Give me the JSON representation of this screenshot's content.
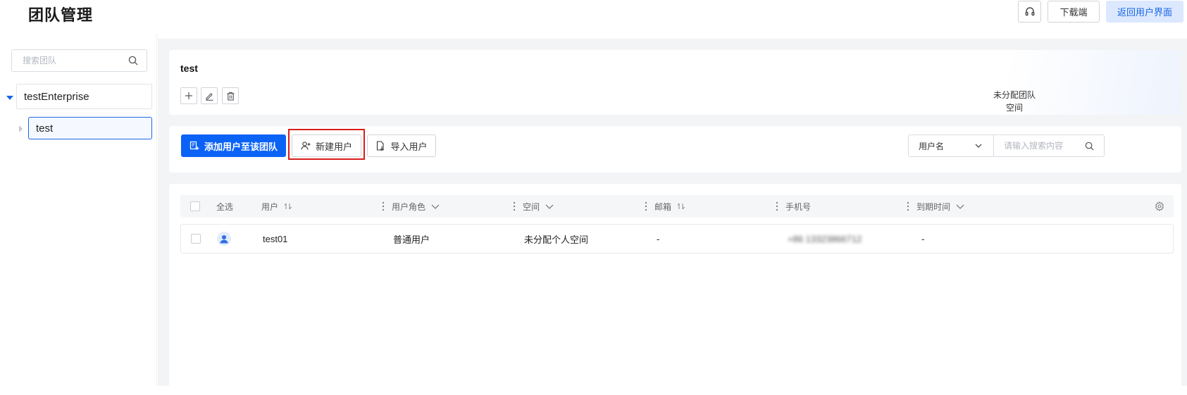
{
  "header": {
    "title": "团队管理",
    "download_label": "下载端",
    "back_label": "返回用户界面"
  },
  "sidebar": {
    "search_placeholder": "搜索团队",
    "tree": {
      "enterprise": "testEnterprise",
      "team": "test"
    }
  },
  "team_card": {
    "name": "test",
    "unassigned_space_line1": "未分配团队",
    "unassigned_space_line2": "空间"
  },
  "actions": {
    "add_to_team_label": "添加用户至该团队",
    "new_user_label": "新建用户",
    "import_user_label": "导入用户",
    "filter_field": "用户名",
    "search_placeholder": "请输入搜索内容"
  },
  "table": {
    "select_all": "全选",
    "columns": [
      "用户",
      "用户角色",
      "空间",
      "邮箱",
      "手机号",
      "到期时间"
    ],
    "rows": [
      {
        "user": "test01",
        "role": "普通用户",
        "space": "未分配个人空间",
        "email": "-",
        "phone": "+86 13323866712",
        "expiry": "-"
      }
    ]
  },
  "colors": {
    "primary": "#0b63f6",
    "highlight": "#d91c1c",
    "back_button_bg": "#dce8fd"
  }
}
